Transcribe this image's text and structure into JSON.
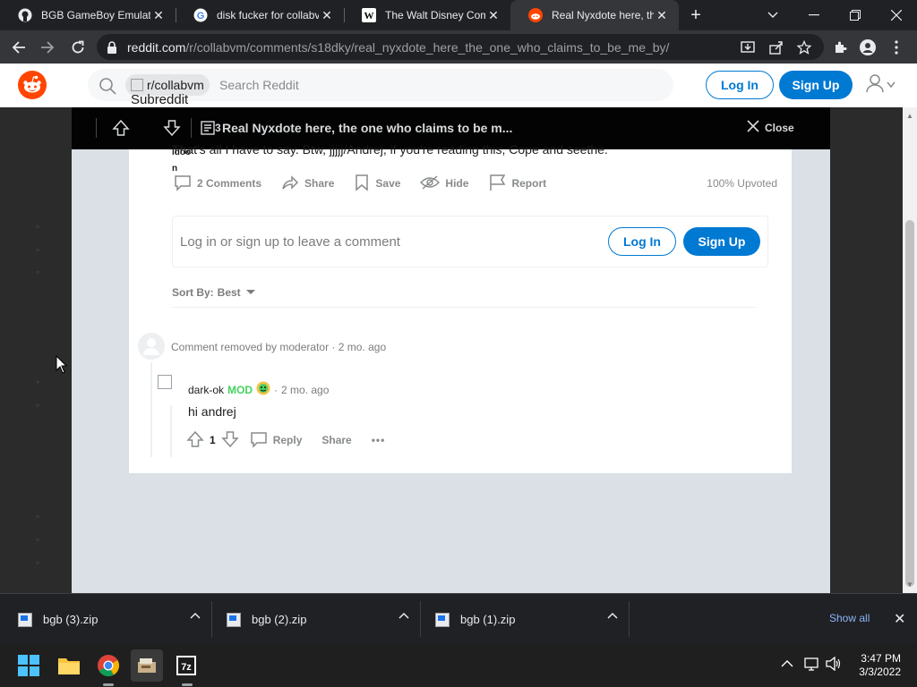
{
  "browser": {
    "tabs": [
      {
        "title": "BGB GameBoy Emulator",
        "icon": "github-icon"
      },
      {
        "title": "disk fucker for collabvm",
        "icon": "google-icon"
      },
      {
        "title": "The Walt Disney Company",
        "icon": "wikipedia-icon"
      },
      {
        "title": "Real Nyxdote here, the one who",
        "icon": "reddit-icon",
        "active": true
      }
    ],
    "url_host": "reddit.com",
    "url_path": "/r/collabvm/comments/s18dky/real_nyxdote_here_the_one_who_claims_to_be_me_by/"
  },
  "header": {
    "subreddit_pill": "r/collabvm",
    "subreddit_caption": "Subreddit",
    "search_placeholder": "Search Reddit",
    "login": "Log In",
    "signup": "Sign Up"
  },
  "post_bar": {
    "vote_count": "3",
    "title": "Real Nyxdote here, the one who claims to be m...",
    "close": "Close"
  },
  "post": {
    "body_clipped": "That's all I have to say. Btw, jjjjj/Andrej, if you're reading this, Cope and seethe.",
    "author_clipped": "ldoo",
    "n_clipped": "n",
    "actions": {
      "comments": "2 Comments",
      "share": "Share",
      "save": "Save",
      "hide": "Hide",
      "report": "Report"
    },
    "upvoted": "100% Upvoted"
  },
  "comment_box": {
    "prompt": "Log in or sign up to leave a comment",
    "login": "Log In",
    "signup": "Sign Up"
  },
  "sort": {
    "label": "Sort By:",
    "value": "Best"
  },
  "comments": [
    {
      "text": "Comment removed by moderator",
      "time": "2 mo. ago"
    },
    {
      "author": "dark-ok",
      "badge": "MOD",
      "time": "2 mo. ago",
      "body": "hi andrej",
      "votes": "1",
      "reply": "Reply",
      "share": "Share",
      "more": "•••"
    }
  ],
  "downloads": [
    {
      "name": "bgb (3).zip"
    },
    {
      "name": "bgb (2).zip"
    },
    {
      "name": "bgb (1).zip"
    }
  ],
  "shelf": {
    "show_all": "Show all"
  },
  "taskbar": {
    "time": "3:47 PM",
    "date": "3/3/2022",
    "apps": [
      "windows-start-icon",
      "file-explorer-icon",
      "chrome-icon",
      "app-icon",
      "7zip-icon"
    ]
  },
  "colors": {
    "reddit_orange": "#ff4500",
    "reddit_blue": "#0079d3",
    "mod_green": "#46d160"
  }
}
